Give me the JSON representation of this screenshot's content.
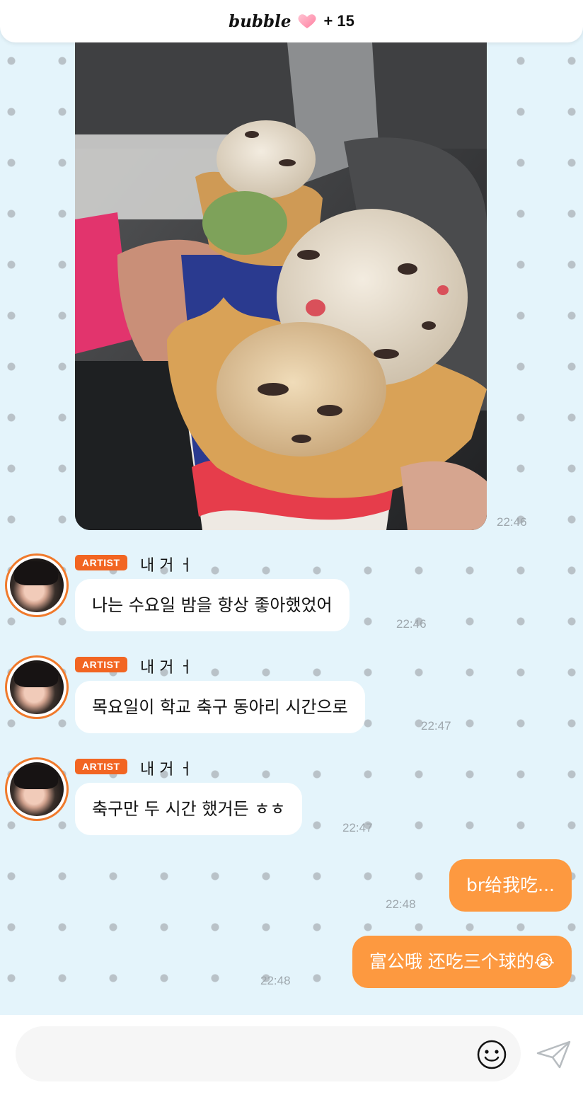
{
  "header": {
    "app_name": "bubble",
    "badge": "+ 15"
  },
  "photo_message": {
    "time": "22:46"
  },
  "messages_in": [
    {
      "badge": "ARTIST",
      "sender": "내 거 ㅓ",
      "text": "나는 수요일 밤을 항상 좋아했었어",
      "time": "22:46"
    },
    {
      "badge": "ARTIST",
      "sender": "내 거 ㅓ",
      "text": "목요일이 학교 축구 동아리 시간으로",
      "time": "22:47"
    },
    {
      "badge": "ARTIST",
      "sender": "내 거 ㅓ",
      "text": "축구만 두 시간 했거든 ㅎㅎ",
      "time": "22:47"
    }
  ],
  "messages_out": [
    {
      "text": "br给我吃...",
      "time": "22:48"
    },
    {
      "text": "富公哦 还吃三个球的😭",
      "time": "22:48"
    }
  ],
  "composer": {
    "value": "",
    "placeholder": ""
  },
  "colors": {
    "background": "#e4f4fb",
    "outgoing_bubble": "#fd9940",
    "artist_badge": "#f26522",
    "avatar_ring": "#f07a2c"
  },
  "icons": [
    "heart-icon",
    "emoji-icon",
    "send-icon"
  ]
}
